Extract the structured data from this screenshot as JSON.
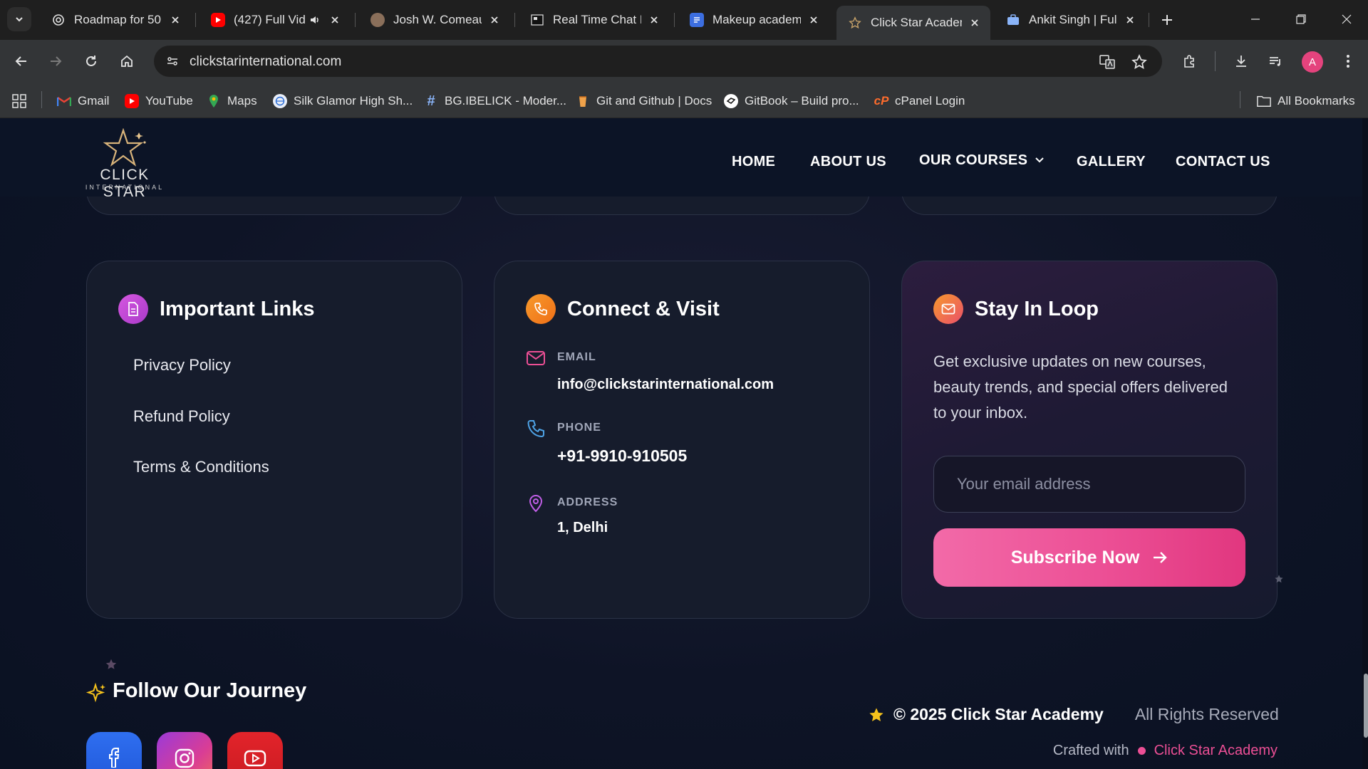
{
  "browser": {
    "tabs": [
      {
        "title": "Roadmap for 50 |",
        "icon": "openai-icon"
      },
      {
        "title": "(427) Full Vid",
        "icon": "youtube-icon"
      },
      {
        "title": "Josh W. Comeau",
        "icon": "avatar-icon"
      },
      {
        "title": "Real Time Chat Pl",
        "icon": "page-icon"
      },
      {
        "title": "Makeup academy",
        "icon": "forms-icon"
      },
      {
        "title": "Click Star Academ",
        "icon": "star-icon",
        "active": true
      },
      {
        "title": "Ankit Singh | Full",
        "icon": "briefcase-icon"
      }
    ],
    "url": "clickstarinternational.com",
    "profile_initial": "A",
    "bookmarks": [
      {
        "label": "Gmail",
        "icon": "gmail-icon"
      },
      {
        "label": "YouTube",
        "icon": "youtube-icon"
      },
      {
        "label": "Maps",
        "icon": "maps-icon"
      },
      {
        "label": "Silk Glamor High Sh...",
        "icon": "globe-icon"
      },
      {
        "label": "BG.IBELICK - Moder...",
        "icon": "hash-icon"
      },
      {
        "label": "Git and Github | Docs",
        "icon": "cup-icon"
      },
      {
        "label": "GitBook – Build pro...",
        "icon": "gitbook-icon"
      },
      {
        "label": "cPanel Login",
        "icon": "cpanel-icon"
      }
    ],
    "all_bookmarks_label": "All Bookmarks"
  },
  "site": {
    "logo": {
      "name": "CLICK STAR",
      "sub": "INTERNATIONAL"
    },
    "nav": {
      "home": "HOME",
      "about": "ABOUT US",
      "courses": "OUR COURSES",
      "gallery": "GALLERY",
      "contact": "CONTACT US"
    }
  },
  "links_card": {
    "title": "Important Links",
    "items": [
      "Privacy Policy",
      "Refund Policy",
      "Terms & Conditions"
    ]
  },
  "connect_card": {
    "title": "Connect & Visit",
    "email_label": "EMAIL",
    "email_value": "info@clickstarinternational.com",
    "phone_label": "PHONE",
    "phone_value": "+91-9910-910505",
    "address_label": "ADDRESS",
    "address_value": "1, Delhi"
  },
  "loop_card": {
    "title": "Stay In Loop",
    "description": "Get exclusive updates on new courses, beauty trends, and special offers delivered to your inbox.",
    "email_placeholder": "Your email address",
    "subscribe_label": "Subscribe Now"
  },
  "footer": {
    "follow_title": "Follow Our Journey",
    "copyright": "© 2025 Click Star Academy",
    "rights": "All Rights Reserved",
    "crafted_prefix": "Crafted with",
    "crafted_brand": "Click Star Academy"
  },
  "colors": {
    "accent_pink": "#ec4f95",
    "accent_orange": "#f07a1e",
    "page_bg": "#0e1426"
  }
}
